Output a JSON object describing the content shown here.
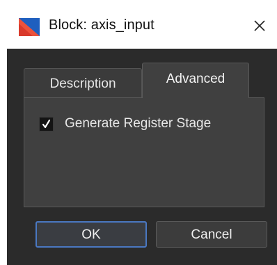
{
  "window": {
    "title": "Block: axis_input",
    "icon": "app-logo-icon",
    "close_icon": "close-icon"
  },
  "tabs": [
    {
      "label": "Description",
      "active": false
    },
    {
      "label": "Advanced",
      "active": true
    }
  ],
  "advanced": {
    "checkbox_label": "Generate Register Stage",
    "checked": true,
    "check_glyph": "✓"
  },
  "buttons": {
    "ok_label": "OK",
    "cancel_label": "Cancel"
  },
  "colors": {
    "body_bg": "#2b2b2b",
    "panel_bg": "#404040",
    "focus_border": "#4a78c2",
    "icon_red": "#d93a2b",
    "icon_blue": "#1f5fbf"
  }
}
